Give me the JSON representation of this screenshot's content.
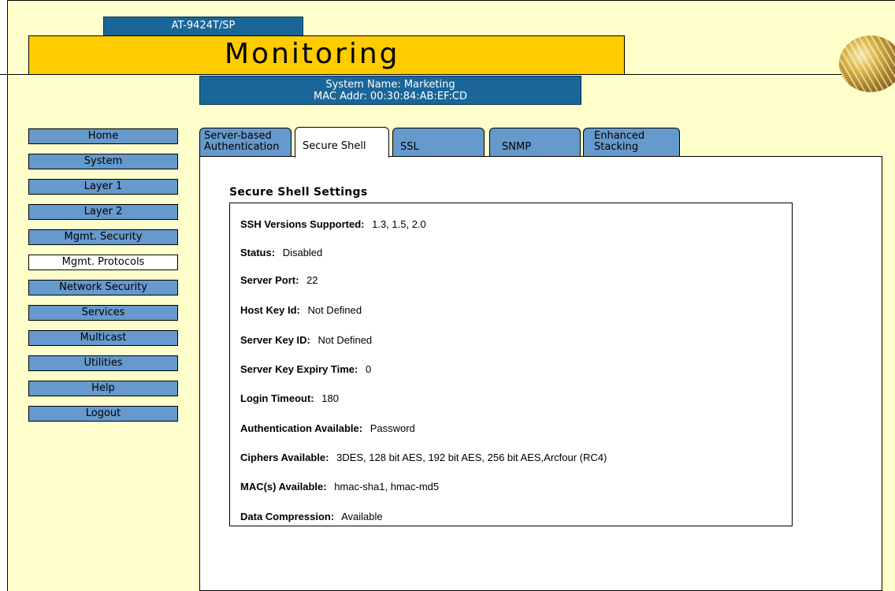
{
  "header": {
    "model": "AT-9424T/SP",
    "title": "Monitoring",
    "system_name": "System Name: Marketing",
    "mac_addr": "MAC Addr: 00:30:84:AB:EF:CD"
  },
  "nav": {
    "items": [
      {
        "label": "Home"
      },
      {
        "label": "System"
      },
      {
        "label": "Layer 1"
      },
      {
        "label": "Layer 2"
      },
      {
        "label": "Mgmt. Security"
      },
      {
        "label": "Mgmt. Protocols",
        "active": true
      },
      {
        "label": "Network Security"
      },
      {
        "label": "Services"
      },
      {
        "label": "Multicast"
      },
      {
        "label": "Utilities"
      },
      {
        "label": "Help"
      },
      {
        "label": "Logout"
      }
    ]
  },
  "tabs": [
    {
      "label_line1": "Server-based",
      "label_line2": "Authentication"
    },
    {
      "label_line1": "Secure Shell",
      "label_line2": "",
      "active": true
    },
    {
      "label_line1": "SSL",
      "label_line2": ""
    },
    {
      "label_line1": "SNMP",
      "label_line2": ""
    },
    {
      "label_line1": "Enhanced",
      "label_line2": "Stacking"
    }
  ],
  "section": {
    "title": "Secure Shell Settings",
    "rows": [
      {
        "label": "SSH Versions Supported:",
        "value": "1.3, 1.5, 2.0"
      },
      {
        "label": "Status:",
        "value": "Disabled"
      },
      {
        "label": "Server Port:",
        "value": "22"
      },
      {
        "label": "Host Key Id:",
        "value": "Not Defined"
      },
      {
        "label": "Server Key ID:",
        "value": "Not Defined"
      },
      {
        "label": "Server Key Expiry Time:",
        "value": "0"
      },
      {
        "label": "Login Timeout:",
        "value": "180"
      },
      {
        "label": "Authentication Available:",
        "value": "Password"
      },
      {
        "label": "Ciphers Available:",
        "value": "3DES, 128 bit AES, 192 bit AES, 256 bit AES,Arcfour (RC4)"
      },
      {
        "label": "MAC(s) Available:",
        "value": "hmac-sha1, hmac-md5"
      },
      {
        "label": "Data Compression:",
        "value": "Available"
      }
    ]
  },
  "colors": {
    "background": "#ffffcc",
    "title_bar": "#ffcc00",
    "header_blue": "#1a6699",
    "nav_blue": "#6699cc"
  }
}
